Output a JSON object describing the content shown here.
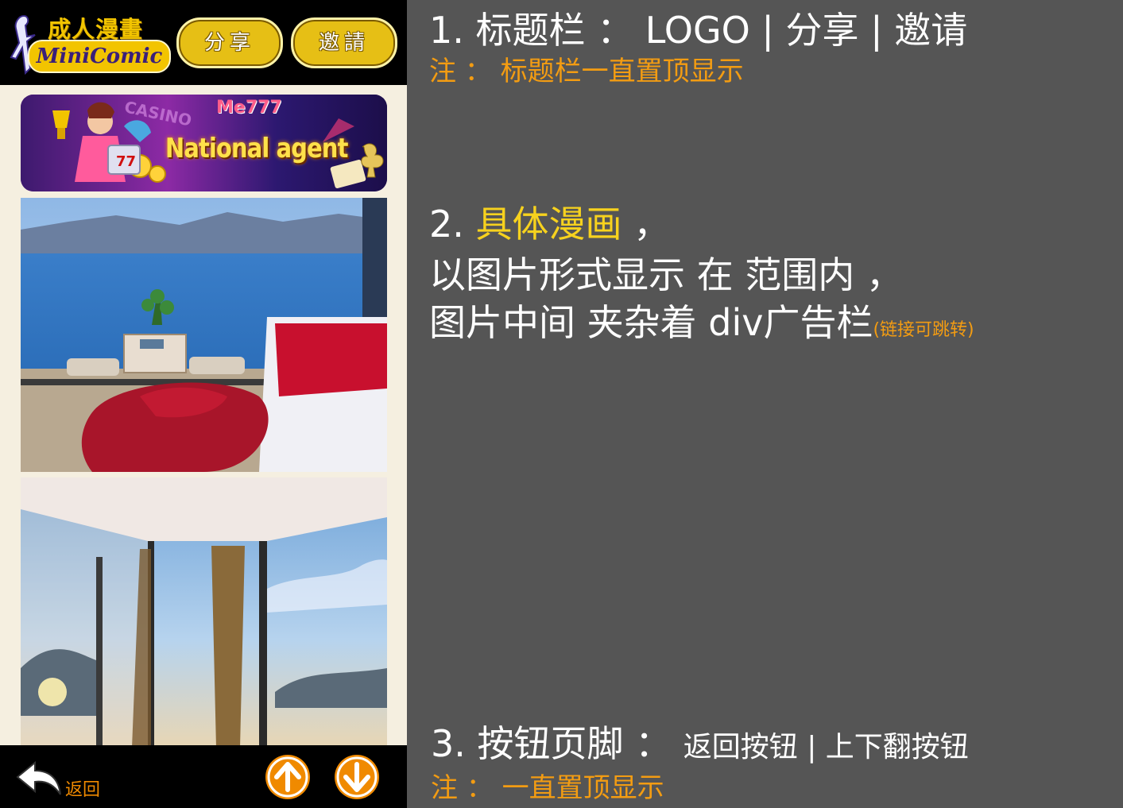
{
  "header": {
    "logo_cn": "成人漫畫",
    "logo_en": "MiniComic",
    "share_label": "分享",
    "invite_label": "邀請"
  },
  "ad": {
    "brand": "Me777",
    "casino": "CASINO",
    "headline": "National agent"
  },
  "footer": {
    "back_label": "返回"
  },
  "notes": {
    "n1_title": "1. 标题栏 ： LOGO | 分享 | 邀请",
    "n1_note": "注 ： 标题栏一直置顶显示",
    "n2_prefix": "2. ",
    "n2_highlight": "具体漫画",
    "n2_suffix": "  ，",
    "n2_line2": "以图片形式显示 在 范围内 ，",
    "n2_line3": "图片中间 夹杂着 div广告栏",
    "n2_small": "(链接可跳转)",
    "n3_title": "3. 按钮页脚 ： ",
    "n3_detail": "返回按钮 | 上下翻按钮",
    "n3_note": "注 ： 一直置顶显示"
  },
  "colors": {
    "accent_gold": "#e6bf15",
    "note_orange": "#f39c12",
    "highlight_yellow": "#f7d21e",
    "panel_gray": "#555555",
    "nav_orange": "#f08a00"
  }
}
